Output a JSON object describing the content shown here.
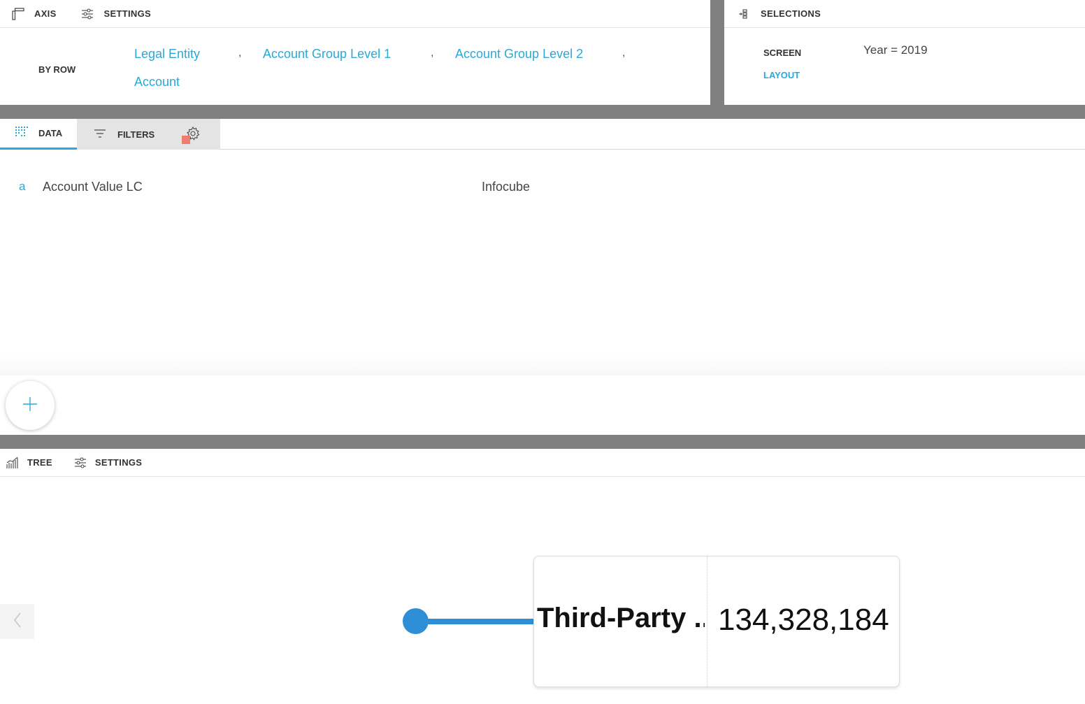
{
  "axis_panel": {
    "tabs": {
      "axis": "AXIS",
      "settings": "SETTINGS"
    },
    "by_row_label": "BY ROW",
    "row_fields": [
      "Legal Entity",
      "Account Group Level 1",
      "Account Group Level 2",
      "Account"
    ],
    "separator": ","
  },
  "selections_panel": {
    "title": "SELECTIONS",
    "screen_label": "SCREEN",
    "layout_label": "LAYOUT",
    "screen_value": "Year = 2019"
  },
  "data_panel": {
    "tabs": {
      "data": "DATA",
      "filters": "FILTERS"
    },
    "row": {
      "prefix": "a",
      "name": "Account Value LC",
      "source": "Infocube"
    }
  },
  "tree_panel": {
    "tabs": {
      "tree": "TREE",
      "settings": "SETTINGS"
    },
    "node": {
      "label": "Third-Party ...",
      "value": "134,328,184"
    }
  },
  "colors": {
    "accent": "#2aa9d9",
    "divider": "#808080",
    "node": "#2f8fd6",
    "status": "#f07b6f"
  },
  "icons": [
    "axis-icon",
    "sliders-icon",
    "selections-icon",
    "grid-data-icon",
    "filter-lines-icon",
    "gear-icon",
    "plus-icon",
    "bar-chart-icon",
    "chevron-left-icon"
  ]
}
